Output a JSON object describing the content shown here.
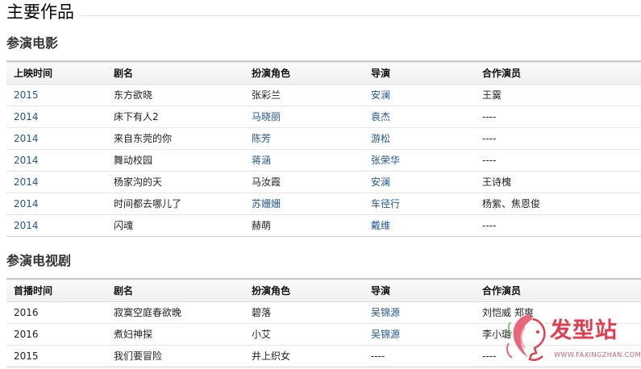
{
  "page": {
    "main_title": "主要作品"
  },
  "films": {
    "title": "参演电影",
    "headers": [
      "上映时间",
      "剧名",
      "扮演角色",
      "导演",
      "合作演员"
    ],
    "rows": [
      {
        "year": "2015",
        "name": "东方欲晓",
        "role": "张彩兰",
        "director": "安澜",
        "costars": "王霙"
      },
      {
        "year": "2014",
        "name": "床下有人2",
        "role": "马晓丽",
        "director": "袁杰",
        "costars": "----"
      },
      {
        "year": "2014",
        "name": "来自东莞的你",
        "role": "陈芳",
        "director": "游松",
        "costars": "----"
      },
      {
        "year": "2014",
        "name": "舞动校园",
        "role": "蒋涵",
        "director": "张荣华",
        "costars": "----"
      },
      {
        "year": "2014",
        "name": "杨家沟的天",
        "role": "马汝霞",
        "director": "安澜",
        "costars": "王诗槐"
      },
      {
        "year": "2014",
        "name": "时间都去哪儿了",
        "role": "苏姗姗",
        "director": "车径行",
        "costars": "杨紫、焦恩俊"
      },
      {
        "year": "2014",
        "name": "闪魂",
        "role": "赫萌",
        "director": "戴维",
        "costars": "----"
      }
    ]
  },
  "tv": {
    "title": "参演电视剧",
    "headers": [
      "首播时间",
      "剧名",
      "扮演角色",
      "导演",
      "合作演员"
    ],
    "rows": [
      {
        "year": "2016",
        "name": "寂寞空庭春欲晚",
        "role": "碧落",
        "director": "吴锦源",
        "costars": "刘恺威 郑爽"
      },
      {
        "year": "2016",
        "name": "煮妇神探",
        "role": "小艾",
        "director": "吴锦源",
        "costars": "李小璐"
      },
      {
        "year": "2015",
        "name": "我们要冒险",
        "role": "井上织女",
        "director": "----",
        "costars": "----"
      }
    ]
  },
  "watermark": {
    "brand": "发型站",
    "url": "WWW.FAXINGZHAN.COM"
  },
  "styles": {
    "link_color": "#24578f",
    "watermark_color": "#e23c4f"
  }
}
